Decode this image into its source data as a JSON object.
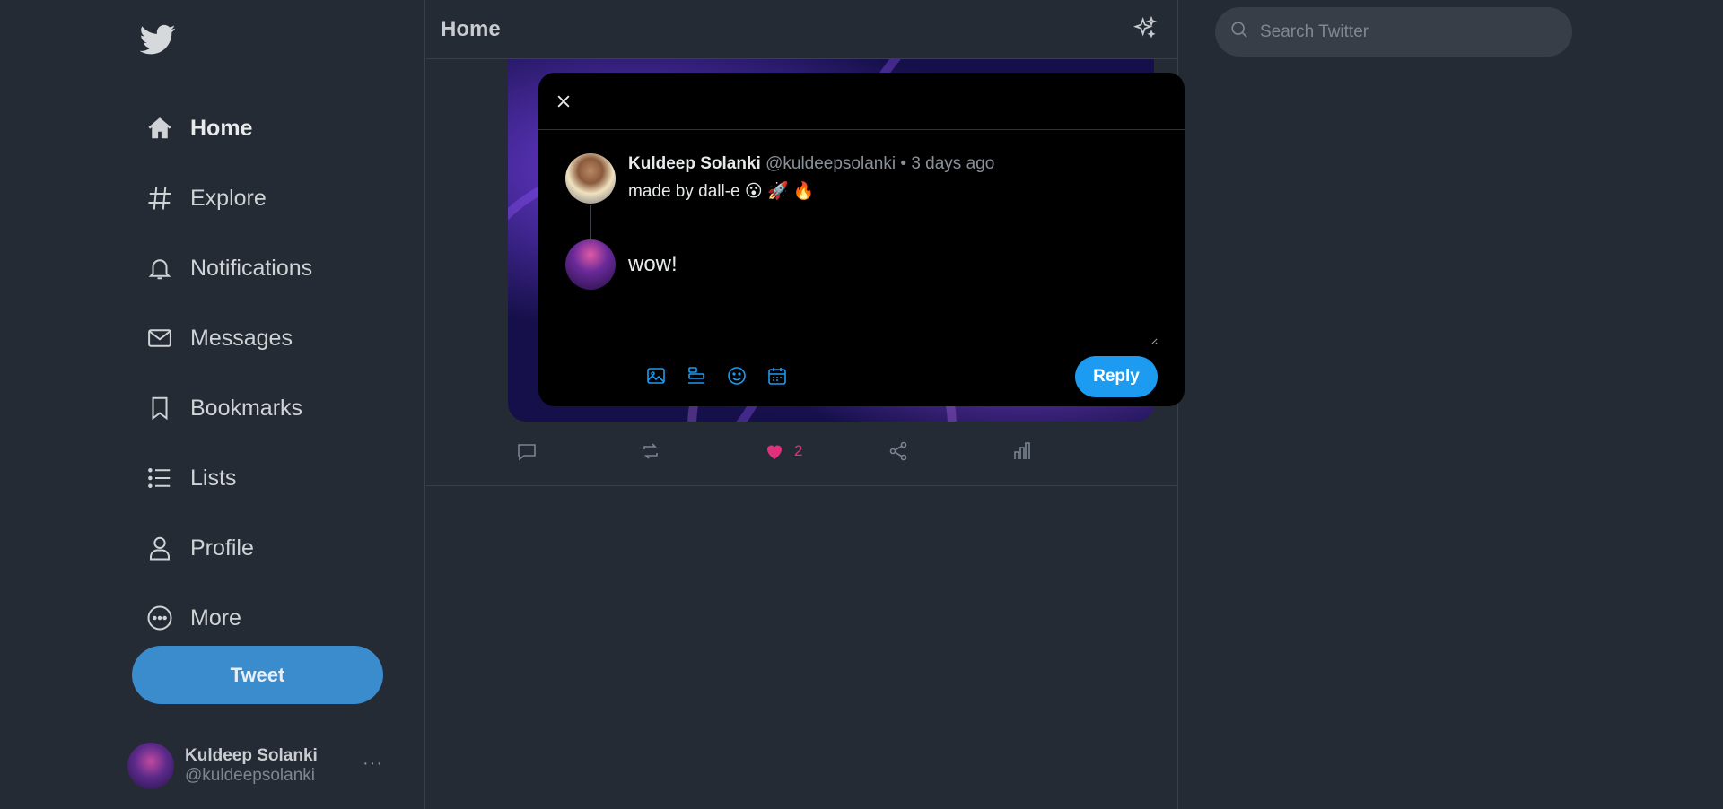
{
  "colors": {
    "background": "#252b34",
    "accent": "#1d9bf0",
    "tweet_button": "#3b8ccc",
    "like": "#e0307e",
    "modal_background": "#000000"
  },
  "sidebar": {
    "logo_icon": "twitter-bird-icon",
    "items": [
      {
        "label": "Home",
        "icon": "home-icon",
        "active": true
      },
      {
        "label": "Explore",
        "icon": "hashtag-icon"
      },
      {
        "label": "Notifications",
        "icon": "bell-icon"
      },
      {
        "label": "Messages",
        "icon": "envelope-icon"
      },
      {
        "label": "Bookmarks",
        "icon": "bookmark-icon"
      },
      {
        "label": "Lists",
        "icon": "list-icon"
      },
      {
        "label": "Profile",
        "icon": "person-icon"
      },
      {
        "label": "More",
        "icon": "more-circle-icon"
      }
    ],
    "tweet_button": "Tweet",
    "account": {
      "name": "Kuldeep Solanki",
      "handle": "@kuldeepsolanki",
      "menu": "···"
    }
  },
  "main": {
    "title": "Home",
    "tweet": {
      "like_count": "2"
    }
  },
  "search": {
    "placeholder": "Search Twitter"
  },
  "reply_modal": {
    "original": {
      "author": "Kuldeep Solanki",
      "handle": "@kuldeepsolanki",
      "separator": "•",
      "time": "3 days ago",
      "text": "made by dall-e 😮 🚀 🔥"
    },
    "reply_value": "wow!",
    "reply_button": "Reply"
  }
}
